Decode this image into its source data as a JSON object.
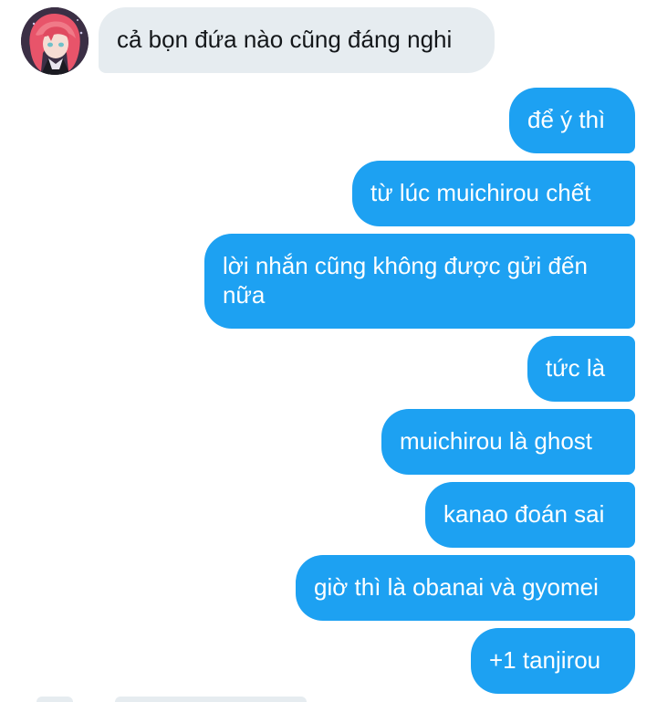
{
  "conversation": {
    "incoming_messages": [
      {
        "text": "cả bọn đứa nào cũng đáng nghi"
      }
    ],
    "outgoing_messages": [
      {
        "text": "để ý thì"
      },
      {
        "text": "từ lúc muichirou chết"
      },
      {
        "text": "lời nhắn cũng không được gửi đến nữa"
      },
      {
        "text": "tức là"
      },
      {
        "text": "muichirou là ghost"
      },
      {
        "text": "kanao đoán sai"
      },
      {
        "text": "giờ thì là obanai và gyomei"
      },
      {
        "text": "+1 tanjirou"
      }
    ]
  },
  "colors": {
    "incoming_bubble": "#e6ecf0",
    "outgoing_bubble": "#1da1f2",
    "incoming_text": "#14171a",
    "outgoing_text": "#ffffff"
  },
  "icons": {
    "avatar": "anime-avatar-pink-hair"
  }
}
